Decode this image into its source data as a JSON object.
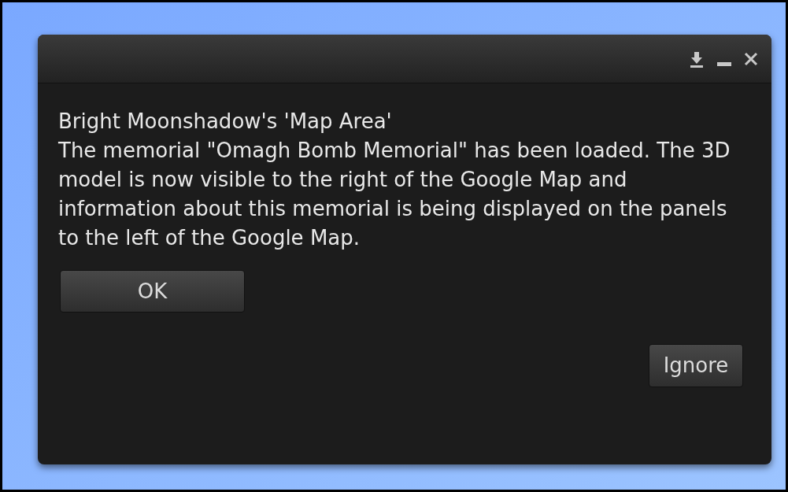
{
  "dialog": {
    "heading": "Bright Moonshadow's 'Map Area'",
    "message": "The memorial \"Omagh Bomb Memorial\" has been loaded. The 3D model is now visible to the right of the Google Map and information about this memorial is being displayed on the panels to the left of the Google Map.",
    "primary_button": "OK",
    "secondary_button": "Ignore"
  }
}
